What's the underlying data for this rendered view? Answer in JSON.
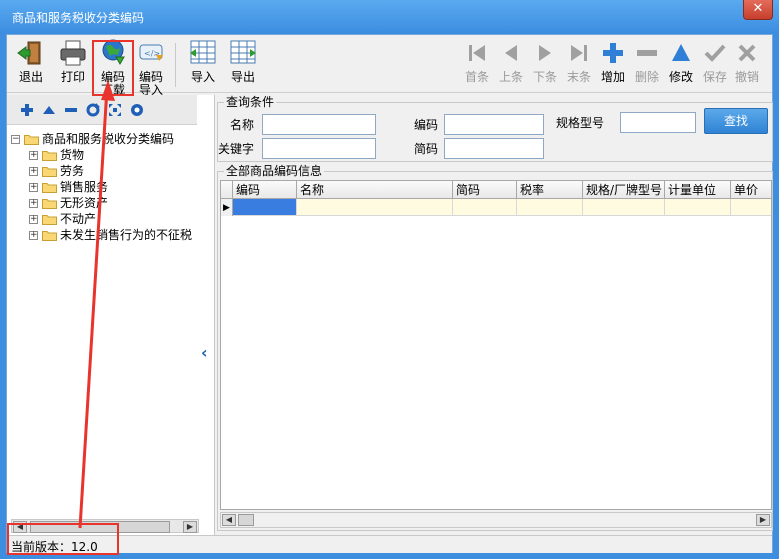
{
  "window": {
    "title": "商品和服务税收分类编码",
    "close_glyph": "✕"
  },
  "toolbar": {
    "exit": "退出",
    "print": "打印",
    "code_download_1": "编码",
    "code_download_2": "下载",
    "code_import_1": "编码",
    "code_import_2": "导入",
    "import": "导入",
    "export": "导出",
    "first": "首条",
    "prev": "上条",
    "next": "下条",
    "last": "末条",
    "add": "增加",
    "delete": "删除",
    "modify": "修改",
    "save": "保存",
    "undo": "撤销"
  },
  "tree": {
    "root": "商品和服务税收分类编码",
    "items": [
      {
        "label": "货物"
      },
      {
        "label": "劳务"
      },
      {
        "label": "销售服务"
      },
      {
        "label": "无形资产"
      },
      {
        "label": "不动产"
      },
      {
        "label": "未发生销售行为的不征税"
      }
    ],
    "expander_glyph": "+",
    "collapse_glyph": "‹"
  },
  "query": {
    "group_title": "查询条件",
    "name_label": "名称",
    "code_label": "编码",
    "spec_label": "规格型号",
    "keyword_label": "关键字",
    "abbr_label": "简码",
    "find_button": "查找"
  },
  "grid": {
    "group_title": "全部商品编码信息",
    "columns": [
      "编码",
      "名称",
      "简码",
      "税率",
      "规格/厂牌型号",
      "计量单位",
      "单价"
    ],
    "row_marker": "▶"
  },
  "status": {
    "version_text": "当前版本：12.0"
  },
  "colors": {
    "title_bar": "#3b8de0",
    "accent_button": "#2f83d4",
    "annotation": "#e8342c",
    "selected_cell": "#3a7de0"
  }
}
